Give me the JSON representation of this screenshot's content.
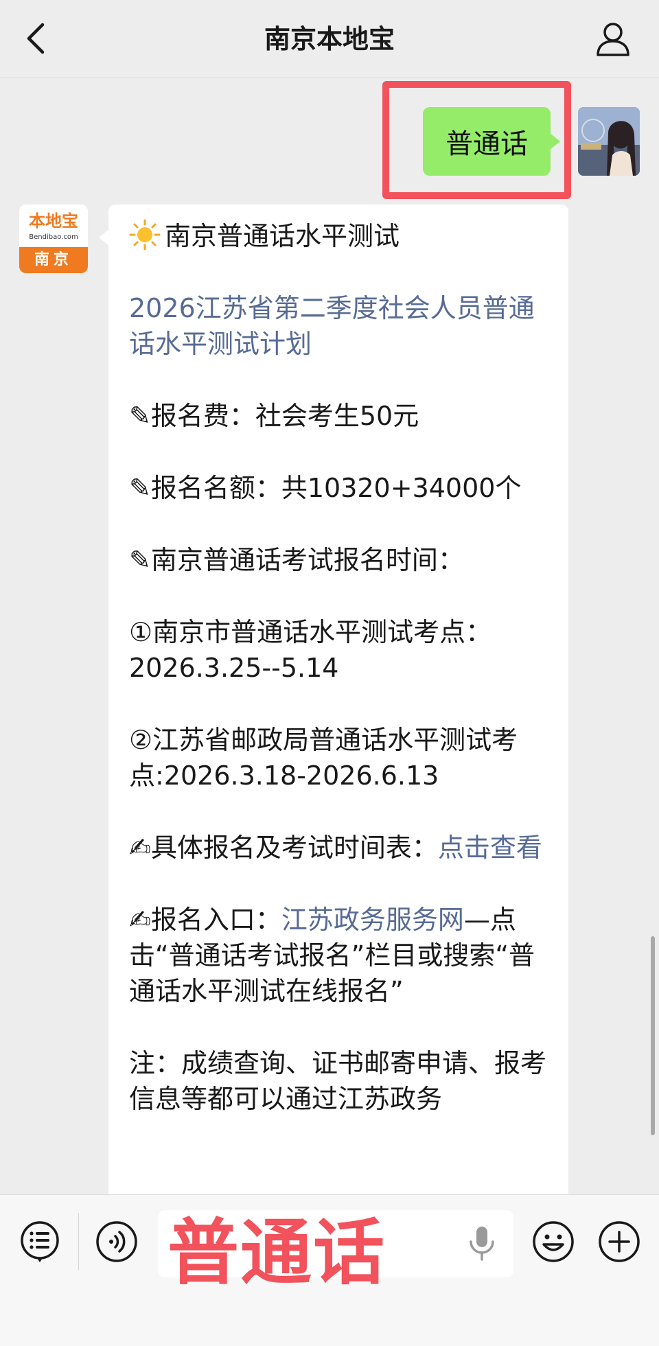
{
  "header": {
    "title": "南京本地宝"
  },
  "chat": {
    "my_message": "普通话",
    "bot_logo": {
      "brand": "本地宝",
      "domain": "Bendibao.com",
      "city": "南京"
    },
    "reply": {
      "line_title": "南京普通话水平测试",
      "plan_link": "2026江苏省第二季度社会人员普通话水平测试计划",
      "fee": "✎报名费：社会考生50元",
      "quota": "✎报名名额：共10320+34000个",
      "time_heading": "✎南京普通话考试报名时间：",
      "site1": "①南京市普通话水平测试考点：2026.3.25--5.14",
      "site2": "②江苏省邮政局普通话水平测试考点:2026.3.18-2026.6.13",
      "schedule_prefix": "✍具体报名及考试时间表：",
      "schedule_link": "点击查看",
      "entry_prefix": "✍报名入口：",
      "entry_link": "江苏政务服务网",
      "entry_suffix": "—点击“普通话考试报名”栏目或搜索“普通话水平测试在线报名”",
      "note": "注：成绩查询、证书邮寄申请、报考信息等都可以通过江苏政务"
    }
  },
  "composer": {
    "input_value": "普通话"
  },
  "colors": {
    "highlight": "#f2525b",
    "my_bubble": "#95ec69",
    "link": "#576b95",
    "brand_orange": "#f07a1f"
  },
  "icons": [
    "back-arrow-icon",
    "user-icon",
    "menu-list-icon",
    "voice-icon",
    "mic-icon",
    "emoji-icon",
    "plus-icon",
    "sun-icon"
  ]
}
